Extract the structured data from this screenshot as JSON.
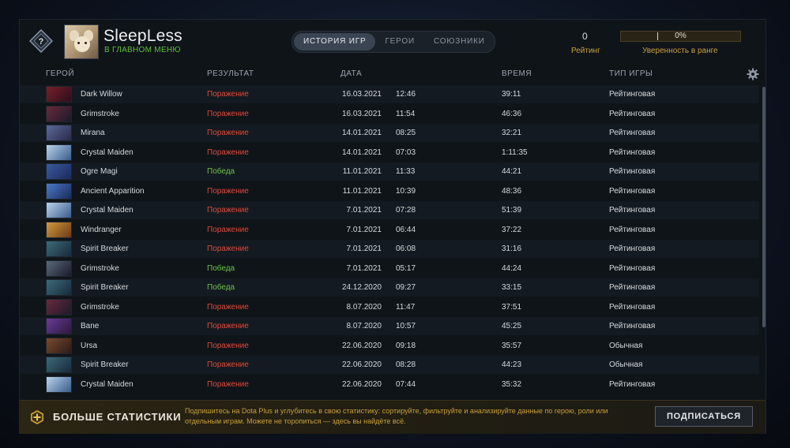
{
  "profile": {
    "username": "SleepLess",
    "status": "В ГЛАВНОМ МЕНЮ",
    "rating_value": "0",
    "rating_label": "Рейтинг",
    "confidence_value": "0%",
    "confidence_fraction": 0,
    "confidence_label": "Уверенность в ранге"
  },
  "tabs": [
    {
      "label": "ИСТОРИЯ ИГР",
      "active": true
    },
    {
      "label": "ГЕРОИ",
      "active": false
    },
    {
      "label": "СОЮЗНИКИ",
      "active": false
    }
  ],
  "columns": {
    "hero": "ГЕРОЙ",
    "result": "РЕЗУЛЬТАТ",
    "date": "ДАТА",
    "duration": "ВРЕМЯ",
    "game_type": "ТИП ИГРЫ"
  },
  "matches": [
    {
      "hero": "Dark Willow",
      "result": "Поражение",
      "win": false,
      "date": "16.03.2021",
      "time": "12:46",
      "duration": "39:11",
      "type": "Рейтинговая",
      "hero_colors": [
        "#7a1f2a",
        "#2a0f1a"
      ]
    },
    {
      "hero": "Grimstroke",
      "result": "Поражение",
      "win": false,
      "date": "16.03.2021",
      "time": "11:54",
      "duration": "46:36",
      "type": "Рейтинговая",
      "hero_colors": [
        "#6a2a3a",
        "#1a1a2a"
      ]
    },
    {
      "hero": "Mirana",
      "result": "Поражение",
      "win": false,
      "date": "14.01.2021",
      "time": "08:25",
      "duration": "32:21",
      "type": "Рейтинговая",
      "hero_colors": [
        "#5a6a9a",
        "#2a2a4a"
      ]
    },
    {
      "hero": "Crystal Maiden",
      "result": "Поражение",
      "win": false,
      "date": "14.01.2021",
      "time": "07:03",
      "duration": "1:11:35",
      "type": "Рейтинговая",
      "hero_colors": [
        "#b9d4ee",
        "#3a5a8a"
      ]
    },
    {
      "hero": "Ogre Magi",
      "result": "Победа",
      "win": true,
      "date": "11.01.2021",
      "time": "11:33",
      "duration": "44:21",
      "type": "Рейтинговая",
      "hero_colors": [
        "#3a5aa0",
        "#1a2a5a"
      ]
    },
    {
      "hero": "Ancient Apparition",
      "result": "Поражение",
      "win": false,
      "date": "11.01.2021",
      "time": "10:39",
      "duration": "48:36",
      "type": "Рейтинговая",
      "hero_colors": [
        "#4a7ac8",
        "#1a2a5a"
      ]
    },
    {
      "hero": "Crystal Maiden",
      "result": "Поражение",
      "win": false,
      "date": "7.01.2021",
      "time": "07:28",
      "duration": "51:39",
      "type": "Рейтинговая",
      "hero_colors": [
        "#b9d4ee",
        "#3a5a8a"
      ]
    },
    {
      "hero": "Windranger",
      "result": "Поражение",
      "win": false,
      "date": "7.01.2021",
      "time": "06:44",
      "duration": "37:22",
      "type": "Рейтинговая",
      "hero_colors": [
        "#d49a3a",
        "#6a3a1a"
      ]
    },
    {
      "hero": "Spirit Breaker",
      "result": "Поражение",
      "win": false,
      "date": "7.01.2021",
      "time": "06:08",
      "duration": "31:16",
      "type": "Рейтинговая",
      "hero_colors": [
        "#3a6a7a",
        "#1a2a3a"
      ]
    },
    {
      "hero": "Grimstroke",
      "result": "Победа",
      "win": true,
      "date": "7.01.2021",
      "time": "05:17",
      "duration": "44:24",
      "type": "Рейтинговая",
      "hero_colors": [
        "#5a6a7a",
        "#1a1a2a"
      ]
    },
    {
      "hero": "Spirit Breaker",
      "result": "Победа",
      "win": true,
      "date": "24.12.2020",
      "time": "09:27",
      "duration": "33:15",
      "type": "Рейтинговая",
      "hero_colors": [
        "#3a6a7a",
        "#1a2a3a"
      ]
    },
    {
      "hero": "Grimstroke",
      "result": "Поражение",
      "win": false,
      "date": "8.07.2020",
      "time": "11:47",
      "duration": "37:51",
      "type": "Рейтинговая",
      "hero_colors": [
        "#6a2a3a",
        "#1a1a2a"
      ]
    },
    {
      "hero": "Bane",
      "result": "Поражение",
      "win": false,
      "date": "8.07.2020",
      "time": "10:57",
      "duration": "45:25",
      "type": "Рейтинговая",
      "hero_colors": [
        "#6a3a9a",
        "#2a1a3a"
      ]
    },
    {
      "hero": "Ursa",
      "result": "Поражение",
      "win": false,
      "date": "22.06.2020",
      "time": "09:18",
      "duration": "35:57",
      "type": "Обычная",
      "hero_colors": [
        "#7a4a2a",
        "#2a1a1a"
      ]
    },
    {
      "hero": "Spirit Breaker",
      "result": "Поражение",
      "win": false,
      "date": "22.06.2020",
      "time": "08:28",
      "duration": "44:23",
      "type": "Обычная",
      "hero_colors": [
        "#3a6a7a",
        "#1a2a3a"
      ]
    },
    {
      "hero": "Crystal Maiden",
      "result": "Поражение",
      "win": false,
      "date": "22.06.2020",
      "time": "07:44",
      "duration": "35:32",
      "type": "Рейтинговая",
      "hero_colors": [
        "#b9d4ee",
        "#3a5a8a"
      ]
    }
  ],
  "footer": {
    "title": "БОЛЬШЕ СТАТИСТИКИ",
    "text": "Подпишитесь на Dota Plus и углубитесь в свою статистику: сортируйте, фильтруйте и анализируйте данные по герою, роли или отдельным играм. Можете не торопиться — здесь вы найдёте всё.",
    "button": "ПОДПИСАТЬСЯ"
  },
  "colors": {
    "loss": "#e04a3a",
    "win": "#6cc24a",
    "gold": "#c9a03c",
    "status_green": "#5fbf3a"
  },
  "icons": {
    "rank": "rank-unknown-icon",
    "settings": "gear-icon",
    "dota_plus": "dota-plus-icon"
  }
}
